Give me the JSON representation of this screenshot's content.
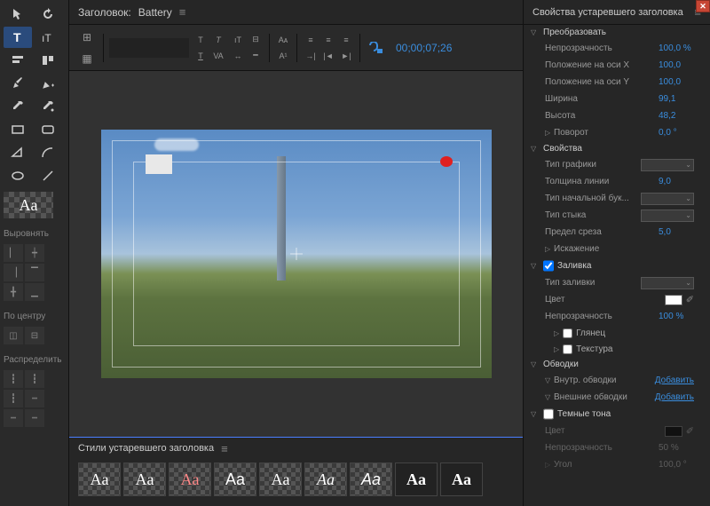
{
  "header": {
    "title_prefix": "Заголовок:",
    "doc_name": "Battery"
  },
  "timecode": "00;00;07;26",
  "tools": {
    "aa": "Aa"
  },
  "left_sections": {
    "align": "Выровнять",
    "center": "По центру",
    "distribute": "Распределить"
  },
  "styles_panel": {
    "title": "Стили устаревшего заголовка",
    "swatch": "Aa"
  },
  "props": {
    "panel_title": "Свойства устаревшего заголовка",
    "groups": {
      "transform": {
        "label": "Преобразовать",
        "opacity": {
          "lbl": "Непрозрачность",
          "val": "100,0 %"
        },
        "posx": {
          "lbl": "Положение на оси X",
          "val": "100,0"
        },
        "posy": {
          "lbl": "Положение на оси Y",
          "val": "100,0"
        },
        "width": {
          "lbl": "Ширина",
          "val": "99,1"
        },
        "height": {
          "lbl": "Высота",
          "val": "48,2"
        },
        "rotation": {
          "lbl": "Поворот",
          "val": "0,0 °"
        }
      },
      "properties": {
        "label": "Свойства",
        "gtype": {
          "lbl": "Тип графики"
        },
        "lwidth": {
          "lbl": "Толщина линии",
          "val": "9,0"
        },
        "caps": {
          "lbl": "Тип начальной бук..."
        },
        "join": {
          "lbl": "Тип стыка"
        },
        "miter": {
          "lbl": "Предел среза",
          "val": "5,0"
        },
        "distort": {
          "lbl": "Искажение"
        }
      },
      "fill": {
        "label": "Заливка",
        "ftype": {
          "lbl": "Тип заливки"
        },
        "color": {
          "lbl": "Цвет"
        },
        "opacity": {
          "lbl": "Непрозрачность",
          "val": "100 %"
        },
        "gloss": {
          "lbl": "Глянец"
        },
        "texture": {
          "lbl": "Текстура"
        }
      },
      "strokes": {
        "label": "Обводки",
        "inner": {
          "lbl": "Внутр. обводки",
          "action": "Добавить"
        },
        "outer": {
          "lbl": "Внешние обводки",
          "action": "Добавить"
        }
      },
      "shadow": {
        "label": "Темные тона",
        "color": {
          "lbl": "Цвет"
        },
        "opacity": {
          "lbl": "Непрозрачность",
          "val": "50 %"
        },
        "angle": {
          "lbl": "Угол",
          "val": "100,0 °"
        }
      }
    }
  }
}
